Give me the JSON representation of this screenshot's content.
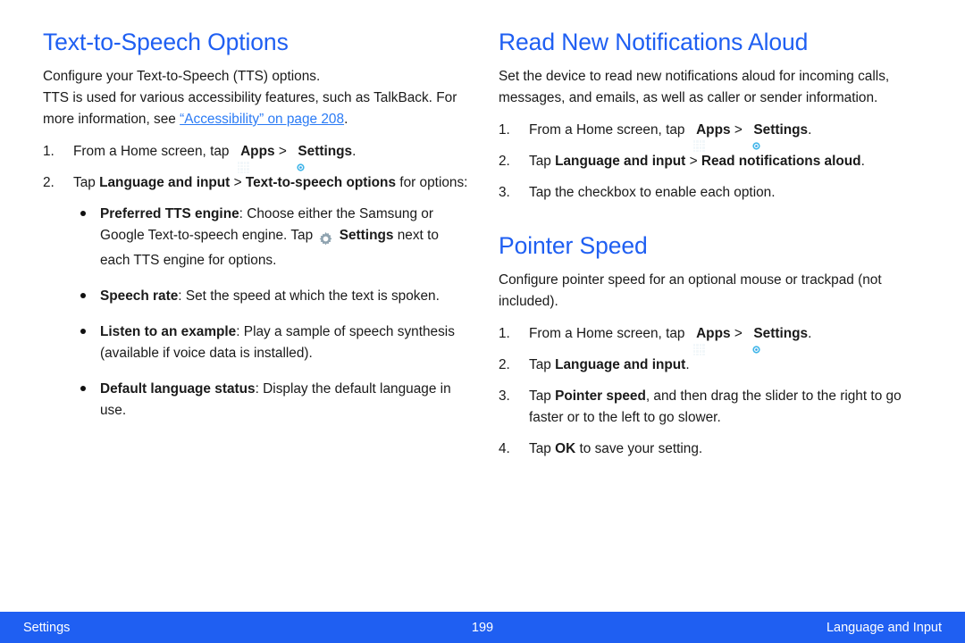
{
  "colors": {
    "heading_blue": "#1f5ff2",
    "link_blue": "#2b7bf5",
    "footer_bar": "#1f5ff2",
    "body_text": "#1a1a1a",
    "apps_icon_bg": "#16323f",
    "settings_icon_bg": "#46c8ef",
    "gear_gray": "#8fa3b0"
  },
  "left_column": {
    "heading": "Text-to-Speech Options",
    "intro_line1": "Configure your Text-to-Speech (TTS) options.",
    "intro_line2_a": "TTS is used for various accessibility features, such as TalkBack. For more information, see ",
    "intro_link": "“Accessibility” on page 208",
    "intro_line2_b": ".",
    "steps": [
      {
        "num": "1.",
        "pre": "From a Home screen, tap ",
        "apps_label": "Apps",
        "sep": " > ",
        "settings_label": "Settings",
        "post": "."
      },
      {
        "num": "2.",
        "pre": "Tap ",
        "bold1": "Language and input",
        "sep": " > ",
        "bold2": "Text-to-speech options",
        "post": " for options:"
      }
    ],
    "bullets": [
      {
        "term": "Preferred TTS engine",
        "text_a": ": Choose either the Samsung or Google Text-to-speech engine. Tap ",
        "gear_label": "Settings",
        "text_b": " next to each TTS engine for options."
      },
      {
        "term": "Speech rate",
        "text_a": ": Set the speed at which the text is spoken."
      },
      {
        "term": "Listen to an example",
        "text_a": ": Play a sample of speech synthesis (available if voice data is installed)."
      },
      {
        "term": "Default language status",
        "text_a": ": Display the default language in use."
      }
    ]
  },
  "right_column": {
    "section1": {
      "heading": "Read New Notifications Aloud",
      "intro": "Set the device to read new notifications aloud for incoming calls, messages, and emails, as well as caller or sender information.",
      "steps": [
        {
          "num": "1.",
          "pre": "From a Home screen, tap ",
          "apps_label": "Apps",
          "sep": " > ",
          "settings_label": "Settings",
          "post": "."
        },
        {
          "num": "2.",
          "pre": "Tap ",
          "bold1": "Language and input",
          "sep": " > ",
          "bold2": "Read notifications aloud",
          "post": "."
        },
        {
          "num": "3.",
          "pre": "Tap the checkbox to enable each option."
        }
      ]
    },
    "section2": {
      "heading": "Pointer Speed",
      "intro": "Configure pointer speed for an optional mouse or trackpad (not included).",
      "steps": [
        {
          "num": "1.",
          "pre": "From a Home screen, tap ",
          "apps_label": "Apps",
          "sep": " > ",
          "settings_label": "Settings",
          "post": "."
        },
        {
          "num": "2.",
          "pre": "Tap ",
          "bold1": "Language and input",
          "post": "."
        },
        {
          "num": "3.",
          "pre": "Tap ",
          "bold1": "Pointer speed",
          "post": ", and then drag the slider to the right to go faster or to the left to go slower."
        },
        {
          "num": "4.",
          "pre": "Tap ",
          "bold1": "OK",
          "post": " to save your setting."
        }
      ]
    }
  },
  "footer": {
    "left": "Settings",
    "page_number": "199",
    "right": "Language and Input"
  }
}
